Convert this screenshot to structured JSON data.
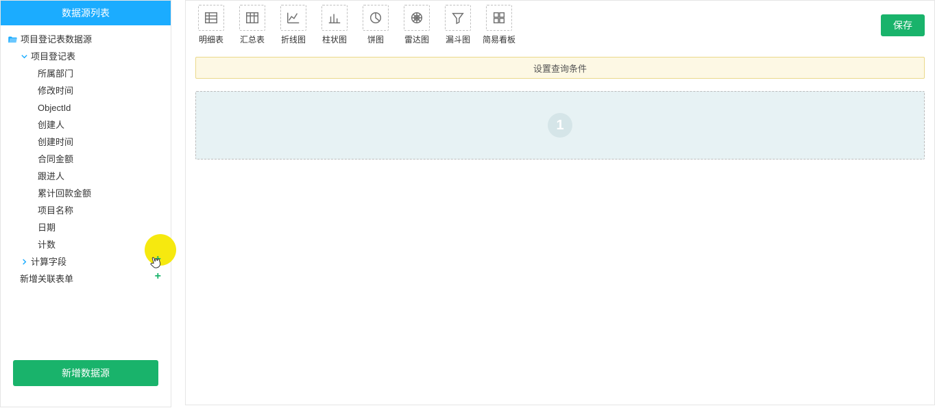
{
  "sidebar": {
    "title": "数据源列表",
    "root_label": "项目登记表数据源",
    "table_label": "项目登记表",
    "fields": [
      "所属部门",
      "修改时间",
      "ObjectId",
      "创建人",
      "创建时间",
      "合同金额",
      "跟进人",
      "累计回款金额",
      "项目名称",
      "日期",
      "计数"
    ],
    "calc_label": "计算字段",
    "add_form_label": "新增关联表单",
    "add_ds_label": "新增数据源"
  },
  "toolbar": {
    "items": [
      {
        "key": "detail",
        "label": "明细表"
      },
      {
        "key": "summary",
        "label": "汇总表"
      },
      {
        "key": "line",
        "label": "折线图"
      },
      {
        "key": "bar",
        "label": "柱状图"
      },
      {
        "key": "pie",
        "label": "饼图"
      },
      {
        "key": "radar",
        "label": "雷达图"
      },
      {
        "key": "funnel",
        "label": "漏斗图"
      },
      {
        "key": "kanban",
        "label": "简易看板"
      }
    ],
    "save_label": "保存"
  },
  "main": {
    "query_bar_label": "设置查询条件",
    "dropzone_number": "1"
  },
  "colors": {
    "primary": "#1bacff",
    "success": "#19b36b",
    "highlight": "#f6e90f"
  }
}
